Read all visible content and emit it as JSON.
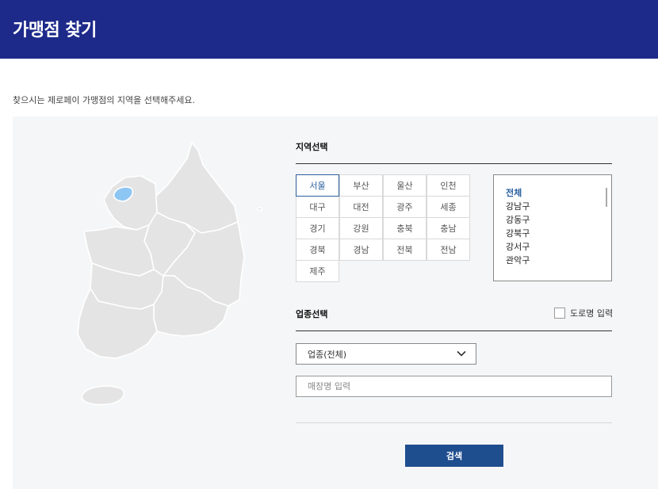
{
  "page": {
    "title": "가맹점 찾기",
    "intro": "찾으시는 제로페이 가맹점의 지역을 선택해주세요."
  },
  "region": {
    "title": "지역선택",
    "cities": [
      "서울",
      "부산",
      "울산",
      "인천",
      "대구",
      "대전",
      "광주",
      "세종",
      "경기",
      "강원",
      "충북",
      "충남",
      "경북",
      "경남",
      "전북",
      "전남",
      "제주"
    ],
    "selected_city": "서울",
    "districts": [
      "전체",
      "강남구",
      "강동구",
      "강북구",
      "강서구",
      "관악구"
    ],
    "selected_district": "전체"
  },
  "business": {
    "title": "업종선택",
    "road_name_label": "도로명 입력",
    "category_value": "업종(전체)",
    "store_placeholder": "매장명 입력"
  },
  "search_button": "검색",
  "colors": {
    "header_bg": "#1d2a8a",
    "accent": "#2a5f9e",
    "button": "#1f4e8f",
    "seoul_highlight": "#8ec6f3"
  }
}
